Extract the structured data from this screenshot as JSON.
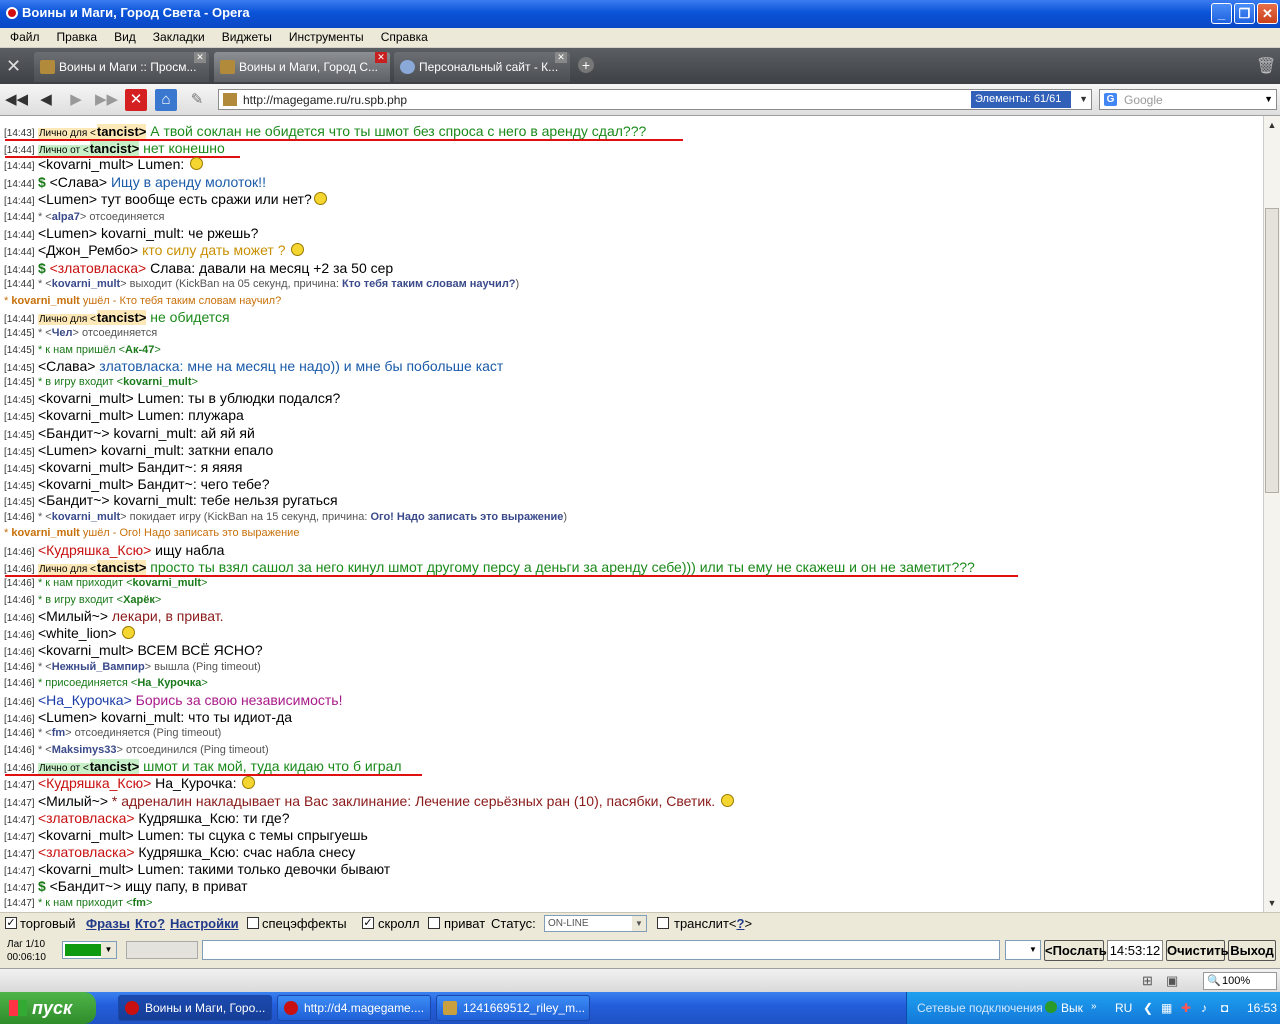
{
  "window": {
    "title": "Воины и Маги, Город Света - Opera"
  },
  "menu": [
    "Файл",
    "Правка",
    "Вид",
    "Закладки",
    "Виджеты",
    "Инструменты",
    "Справка"
  ],
  "tabs": [
    {
      "label": "Воины и Маги :: Просм..."
    },
    {
      "label": "Воины и Маги, Город С..."
    },
    {
      "label": "Персональный сайт - К..."
    }
  ],
  "address": {
    "url": "http://magegame.ru/ru.spb.php",
    "elements": "Элементы:  61/61",
    "search_placeholder": "Google"
  },
  "chat": [
    {
      "ts": "[14:43]",
      "pre": "Лично для <",
      "nick": "tancist",
      "post": ">",
      "msg": " А твой соклан не обидется что ты шмот без спроса с него в аренду сдал???",
      "kind": "privfor"
    },
    {
      "ts": "[14:44]",
      "pre": "Лично от <",
      "nick": "tancist",
      "post": ">",
      "msg": " нет конешно",
      "kind": "privfrom"
    },
    {
      "ts": "[14:44]",
      "nick": "<kovarni_mult>",
      "msg": " Lumen: ",
      "kind": "big",
      "smile": true
    },
    {
      "ts": "[14:44]",
      "pre": "$ ",
      "nick": "<Слава>",
      "msg": " Ищу в аренду молоток!!",
      "kind": "big",
      "mc": "#1a5aa8"
    },
    {
      "ts": "[14:44]",
      "nick": "<Lumen>",
      "msg": " тут вообще есть сражи или нет?",
      "kind": "big",
      "smile": true
    },
    {
      "ts": "[14:44]",
      "pre": "* <",
      "nick": "alpa7",
      "post": ">",
      "msg": " отсоединяется",
      "kind": "sys"
    },
    {
      "ts": "[14:44]",
      "nick": "<Lumen>",
      "msg": " kovarni_mult: че ржешь?",
      "kind": "big"
    },
    {
      "ts": "[14:44]",
      "nick": "<Джон_Рембо>",
      "msg": " кто силу дать может ? ",
      "kind": "big",
      "mc": "#c89000",
      "smile": true
    },
    {
      "ts": "[14:44]",
      "pre": "$ ",
      "nick": "<златовласка>",
      "msg": " Слава: давали на месяц +2 за 50 сер",
      "kind": "big",
      "nc": "#c81010"
    },
    {
      "ts": "[14:44]",
      "pre": "* <",
      "nick": "kovarni_mult",
      "post": ">",
      "msg": " выходит (KickBan на 05 секунд, причина: ",
      "bold": "Кто тебя таким словам научил?",
      "tail": ")",
      "kind": "sys"
    },
    {
      "pre": "* ",
      "nick": "kovarni_mult",
      "msg": " ушёл - Кто тебя таким словам научил?",
      "kind": "left"
    },
    {
      "ts": "[14:44]",
      "pre": "Лично для <",
      "nick": "tancist",
      "post": ">",
      "msg": " не обидется",
      "kind": "privfor2"
    },
    {
      "ts": "[14:45]",
      "pre": "* <",
      "nick": "Чел",
      "post": ">",
      "msg": " отсоединяется",
      "kind": "sys"
    },
    {
      "ts": "[14:45]",
      "pre": "* к нам пришёл <",
      "nick": "Ак-47",
      "post": ">",
      "kind": "sysg"
    },
    {
      "ts": "[14:45]",
      "nick": "<Слава>",
      "msg": " златовласка: мне на месяц не надо)) и мне бы побольше каст",
      "kind": "big",
      "mc": "#1a5aa8"
    },
    {
      "ts": "[14:45]",
      "pre": "* в игру входит <",
      "nick": "kovarni_mult",
      "post": ">",
      "kind": "sysg"
    },
    {
      "ts": "[14:45]",
      "nick": "<kovarni_mult>",
      "msg": " Lumen: ты в ублюдки подался?",
      "kind": "big"
    },
    {
      "ts": "[14:45]",
      "nick": "<kovarni_mult>",
      "msg": " Lumen: плужара",
      "kind": "big"
    },
    {
      "ts": "[14:45]",
      "nick": "<Бандит~>",
      "msg": " kovarni_mult: ай яй яй",
      "kind": "big"
    },
    {
      "ts": "[14:45]",
      "nick": "<Lumen>",
      "msg": " kovarni_mult: заткни епало",
      "kind": "big"
    },
    {
      "ts": "[14:45]",
      "nick": "<kovarni_mult>",
      "msg": " Бандит~: я яяяя",
      "kind": "big"
    },
    {
      "ts": "[14:45]",
      "nick": "<kovarni_mult>",
      "msg": " Бандит~: чего тебе?",
      "kind": "big"
    },
    {
      "ts": "[14:45]",
      "nick": "<Бандит~>",
      "msg": " kovarni_mult: тебе нельзя ругаться",
      "kind": "big"
    },
    {
      "ts": "[14:46]",
      "pre": "* <",
      "nick": "kovarni_mult",
      "post": ">",
      "msg": " покидает игру (KickBan на 15 секунд, причина: ",
      "bold": "Ого! Надо записать это выражение",
      "tail": ")",
      "kind": "sys"
    },
    {
      "pre": "* ",
      "nick": "kovarni_mult",
      "msg": " ушёл - Ого! Надо записать это выражение",
      "kind": "left"
    },
    {
      "ts": "[14:46]",
      "nick": "<Кудряшка_Ксю>",
      "msg": " ищу набла",
      "kind": "big",
      "nc": "#c81010"
    },
    {
      "ts": "[14:46]",
      "pre": "Лично для <",
      "nick": "tancist",
      "post": ">",
      "msg": " просто ты взял сашол за него кинул шмот другому персу а деньги за аренду себе))) или ты ему не скажеш и он не заметит???",
      "kind": "privfor"
    },
    {
      "ts": "[14:46]",
      "pre": "* к нам приходит <",
      "nick": "kovarni_mult",
      "post": ">",
      "kind": "sysg"
    },
    {
      "ts": "[14:46]",
      "pre": "* в игру входит <",
      "nick": "Харёк",
      "post": ">",
      "kind": "sysg"
    },
    {
      "ts": "[14:46]",
      "nick": "<Милый~>",
      "msg": " лекари, в приват.",
      "kind": "big",
      "mc": "#8a1a1a"
    },
    {
      "ts": "[14:46]",
      "nick": "<white_lion>",
      "msg": " ",
      "kind": "big",
      "smile": true
    },
    {
      "ts": "[14:46]",
      "nick": "<kovarni_mult>",
      "msg": " ВСЕМ ВСЁ ЯСНО?",
      "kind": "big"
    },
    {
      "ts": "[14:46]",
      "pre": "* <",
      "nick": "Нежный_Вампир",
      "post": ">",
      "msg": " вышла (Ping timeout)",
      "kind": "sys"
    },
    {
      "ts": "[14:46]",
      "pre": "* присоединяется <",
      "nick": "На_Курочка",
      "post": ">",
      "kind": "sysg"
    },
    {
      "ts": "[14:46]",
      "nick": "<На_Курочка>",
      "msg": " Борись за свою независимость!",
      "kind": "big",
      "nc": "#1a3aa8",
      "mc": "#a81a8a"
    },
    {
      "ts": "[14:46]",
      "nick": "<Lumen>",
      "msg": " kovarni_mult: что ты идиот-да",
      "kind": "big"
    },
    {
      "ts": "[14:46]",
      "pre": "* <",
      "nick": "fm",
      "post": ">",
      "msg": " отсоединяется (Ping timeout)",
      "kind": "sys"
    },
    {
      "ts": "[14:46]",
      "pre": "* <",
      "nick": "Maksimys33",
      "post": ">",
      "msg": " отсоединился (Ping timeout)",
      "kind": "sys"
    },
    {
      "ts": "[14:46]",
      "pre": "Лично от <",
      "nick": "tancist",
      "post": ">",
      "msg": " шмот и так мой, туда кидаю что б играл",
      "kind": "privfrom"
    },
    {
      "ts": "[14:47]",
      "nick": "<Кудряшка_Ксю>",
      "msg": " На_Курочка: ",
      "kind": "big",
      "nc": "#c81010",
      "smile": true
    },
    {
      "ts": "[14:47]",
      "nick": "<Милый~>",
      "msg": " * адреналин накладывает на Вас заклинание: Лечение серьёзных ран (10), пасябки, Светик. ",
      "kind": "big",
      "mc": "#8a1a1a",
      "smile": true
    },
    {
      "ts": "[14:47]",
      "nick": "<златовласка>",
      "msg": " Кудряшка_Ксю: ти где?",
      "kind": "big",
      "nc": "#c81010"
    },
    {
      "ts": "[14:47]",
      "nick": "<kovarni_mult>",
      "msg": " Lumen: ты сцука с темы спрыгуешь",
      "kind": "big"
    },
    {
      "ts": "[14:47]",
      "nick": "<златовласка>",
      "msg": " Кудряшка_Ксю: счас набла снесу",
      "kind": "big",
      "nc": "#c81010"
    },
    {
      "ts": "[14:47]",
      "nick": "<kovarni_mult>",
      "msg": " Lumen: такими только девочки бывают",
      "kind": "big"
    },
    {
      "ts": "[14:47]",
      "pre": "$ ",
      "nick": "<Бандит~>",
      "msg": " ищу папу, в приват",
      "kind": "big"
    },
    {
      "ts": "[14:47]",
      "pre": "* к нам приходит <",
      "nick": "fm",
      "post": ">",
      "kind": "sysg"
    }
  ],
  "options": {
    "trade": "торговый",
    "phrases": "Фразы",
    "who": "Кто?",
    "settings": "Настройки",
    "effects": "спецэффекты",
    "scroll": "скролл",
    "private": "приват",
    "status_label": "Статус:",
    "status_value": "ON-LINE",
    "translit": "транслит<",
    "translit_q": "?",
    "translit_end": ">"
  },
  "input": {
    "lag": "Лаг 1/10",
    "timer": "00:06:10",
    "send": "<Послать",
    "clock": "14:53:12",
    "clear": "Очистить",
    "exit": "Выход"
  },
  "statusbar": {
    "zoom": "100%"
  },
  "taskbar": {
    "start": "пуск",
    "tasks": [
      "Воины и Маги, Горо...",
      "http://d4.magegame....",
      "1241669512_riley_m..."
    ],
    "network": "Сетевые подключения",
    "vyk": "Вык",
    "lang": "RU",
    "time": "16:53"
  }
}
